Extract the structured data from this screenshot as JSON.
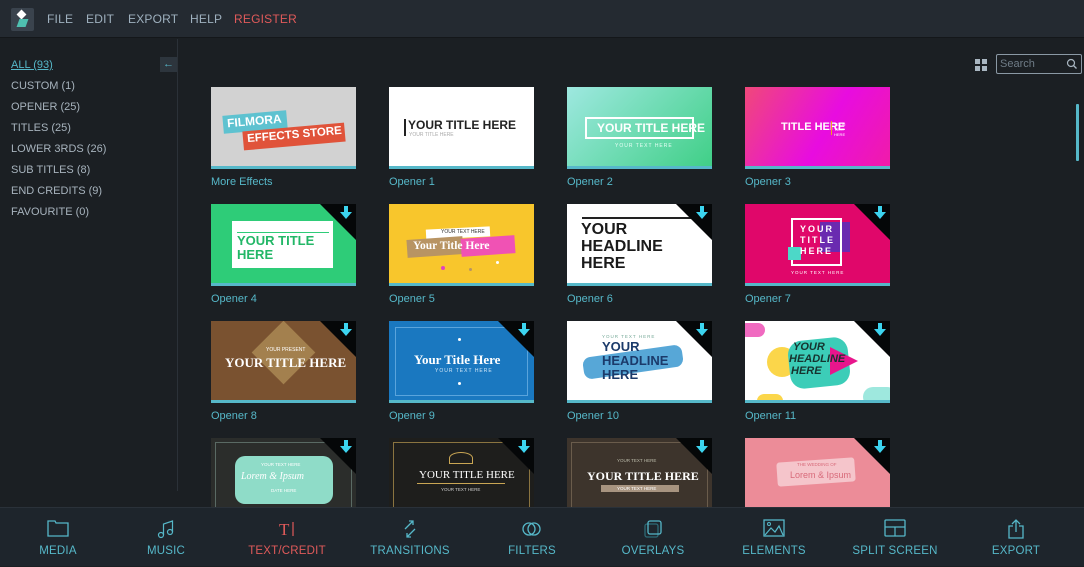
{
  "menubar": {
    "items": [
      "FILE",
      "EDIT",
      "EXPORT",
      "HELP"
    ],
    "register": "REGISTER"
  },
  "sidebar": {
    "categories": [
      {
        "label": "ALL (93)",
        "active": true
      },
      {
        "label": "CUSTOM (1)"
      },
      {
        "label": "OPENER (25)"
      },
      {
        "label": "TITLES (25)"
      },
      {
        "label": "LOWER 3RDS (26)"
      },
      {
        "label": "SUB TITLES (8)"
      },
      {
        "label": "END CREDITS (9)"
      },
      {
        "label": "FAVOURITE (0)"
      }
    ],
    "collapse_icon": "arrow-left-icon"
  },
  "toolbar": {
    "view_icon": "grid-view-icon",
    "search_placeholder": "Search",
    "search_value": "",
    "search_icon": "search-icon"
  },
  "tiles": [
    {
      "label": "More Effects",
      "thumb": {
        "t1": "FILMORA",
        "t2": "EFFECTS STORE"
      }
    },
    {
      "label": "Opener 1",
      "thumb": {
        "t1": "YOUR TITLE HERE",
        "t2": "YOUR TITLE HERE"
      }
    },
    {
      "label": "Opener 2",
      "thumb": {
        "t1": "YOUR TITLE HERE",
        "t2": "YOUR TEXT HERE"
      }
    },
    {
      "label": "Opener 3",
      "thumb": {
        "t1": "TITLE HERE",
        "t2": "YOUR TEXT HERE"
      }
    },
    {
      "label": "Opener 4",
      "download": true,
      "thumb": {
        "t1": "YOUR TITLE",
        "t2": "HERE"
      }
    },
    {
      "label": "Opener 5",
      "thumb": {
        "t1": "YOUR TEXT HERE",
        "t2": "Your Title Here"
      }
    },
    {
      "label": "Opener 6",
      "download": true,
      "thumb": {
        "t1": "YOUR",
        "t2": "HEADLINE",
        "t3": "HERE"
      }
    },
    {
      "label": "Opener 7",
      "download": true,
      "thumb": {
        "t1": "YOUR",
        "t2": "TITLE",
        "t3": "HERE",
        "t4": "YOUR TEXT HERE"
      }
    },
    {
      "label": "Opener 8",
      "download": true,
      "thumb": {
        "t1": "YOUR PRESENT",
        "t2": "YOUR TITLE HERE"
      }
    },
    {
      "label": "Opener 9",
      "download": true,
      "thumb": {
        "t1": "Your Title Here",
        "t2": "YOUR TEXT HERE"
      }
    },
    {
      "label": "Opener 10",
      "download": true,
      "thumb": {
        "t1": "YOUR TEXT HERE",
        "t2": "YOUR",
        "t3": "HEADLINE",
        "t4": "HERE"
      }
    },
    {
      "label": "Opener 11",
      "download": true,
      "thumb": {
        "t1": "YOUR",
        "t2": "HEADLINE",
        "t3": "HERE"
      }
    },
    {
      "label": "",
      "download": true,
      "thumb": {
        "t1": "YOUR TEXT HERE",
        "t2": "Lorem & Ipsum",
        "t3": "DATE HERE"
      }
    },
    {
      "label": "",
      "download": true,
      "thumb": {
        "t1": "YOUR TITLE HERE",
        "t2": "YOUR TEXT HERE"
      }
    },
    {
      "label": "",
      "download": true,
      "thumb": {
        "t1": "YOUR TEXT HERE",
        "t2": "YOUR TITLE HERE",
        "t3": "YOUR TEXT HERE"
      }
    },
    {
      "label": "",
      "download": true,
      "thumb": {
        "t1": "THE WEDDING OF",
        "t2": "Lorem & Ipsum"
      }
    }
  ],
  "bottombar": {
    "items": [
      {
        "label": "MEDIA",
        "icon": "folder-icon"
      },
      {
        "label": "MUSIC",
        "icon": "music-note-icon"
      },
      {
        "label": "TEXT/CREDIT",
        "icon": "text-icon",
        "active": true
      },
      {
        "label": "TRANSITIONS",
        "icon": "transitions-icon"
      },
      {
        "label": "FILTERS",
        "icon": "filters-icon"
      },
      {
        "label": "OVERLAYS",
        "icon": "overlays-icon"
      },
      {
        "label": "ELEMENTS",
        "icon": "image-icon"
      },
      {
        "label": "SPLIT SCREEN",
        "icon": "split-screen-icon"
      },
      {
        "label": "EXPORT",
        "icon": "export-icon"
      }
    ]
  },
  "colors": {
    "accent": "#56b8c9",
    "active": "#e05a5a",
    "background": "#1b1f23",
    "menubar": "#242a31"
  }
}
